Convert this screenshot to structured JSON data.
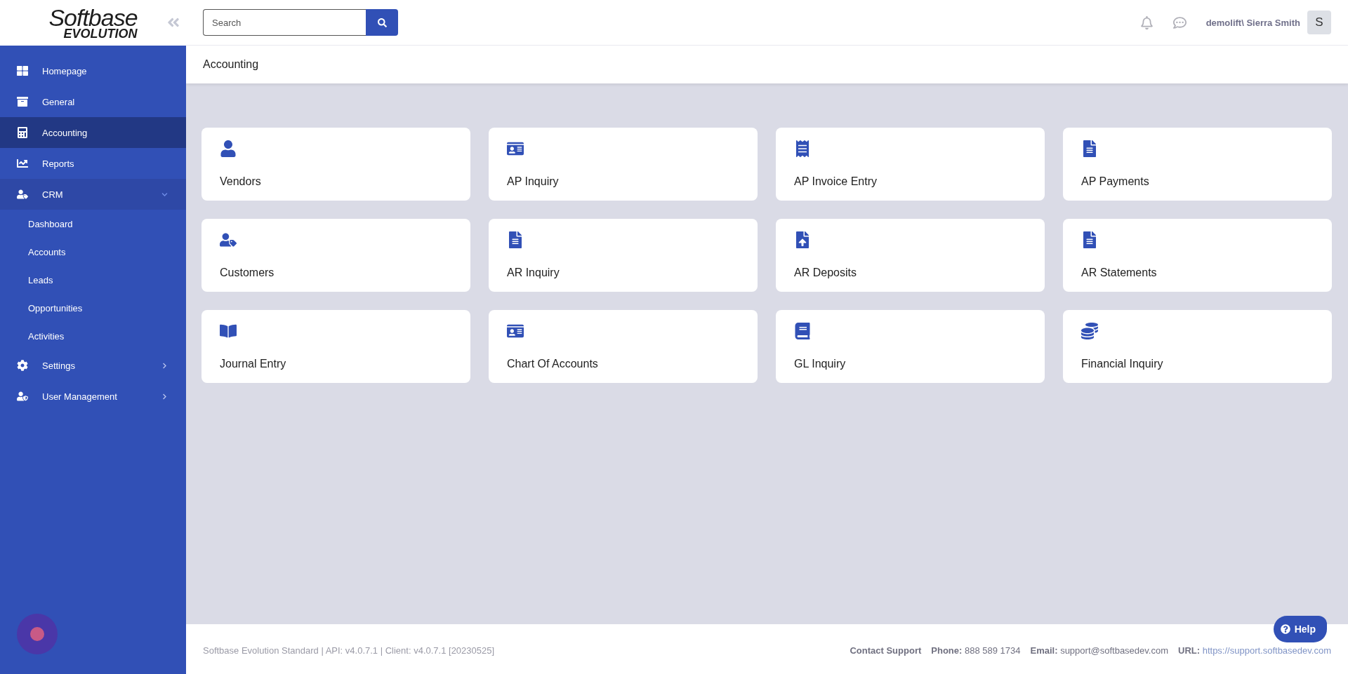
{
  "logo": {
    "line1": "Softbase",
    "line2": "EVOLUTION"
  },
  "search": {
    "placeholder": "Search"
  },
  "user": {
    "name": "demolift\\ Sierra Smith",
    "initial": "S"
  },
  "sidebar": {
    "items": [
      {
        "label": "Homepage",
        "selected": false
      },
      {
        "label": "General",
        "selected": false
      },
      {
        "label": "Accounting",
        "selected": true
      },
      {
        "label": "Reports",
        "selected": false
      },
      {
        "label": "CRM",
        "selected": false,
        "expanded": true,
        "children": [
          {
            "label": "Dashboard"
          },
          {
            "label": "Accounts"
          },
          {
            "label": "Leads"
          },
          {
            "label": "Opportunities"
          },
          {
            "label": "Activities"
          }
        ]
      },
      {
        "label": "Settings",
        "selected": false,
        "expanded": false
      },
      {
        "label": "User Management",
        "selected": false,
        "expanded": false
      }
    ]
  },
  "breadcrumb": "Accounting",
  "cards": [
    {
      "label": "Vendors"
    },
    {
      "label": "AP Inquiry"
    },
    {
      "label": "AP Invoice Entry"
    },
    {
      "label": "AP Payments"
    },
    {
      "label": "Customers"
    },
    {
      "label": "AR Inquiry"
    },
    {
      "label": "AR Deposits"
    },
    {
      "label": "AR Statements"
    },
    {
      "label": "Journal Entry"
    },
    {
      "label": "Chart Of Accounts"
    },
    {
      "label": "GL Inquiry"
    },
    {
      "label": "Financial Inquiry"
    }
  ],
  "footer": {
    "version": "Softbase Evolution Standard | API: v4.0.7.1 | Client: v4.0.7.1 [20230525]",
    "contact": "Contact Support",
    "fields": [
      {
        "label": "Phone:",
        "value": "888 589 1734",
        "kind": "text"
      },
      {
        "label": "Email:",
        "value": "support@softbasedev.com",
        "kind": "text"
      },
      {
        "label": "URL:",
        "value": "https://support.softbasedev.com",
        "kind": "link"
      }
    ]
  },
  "help": {
    "label": "Help"
  }
}
